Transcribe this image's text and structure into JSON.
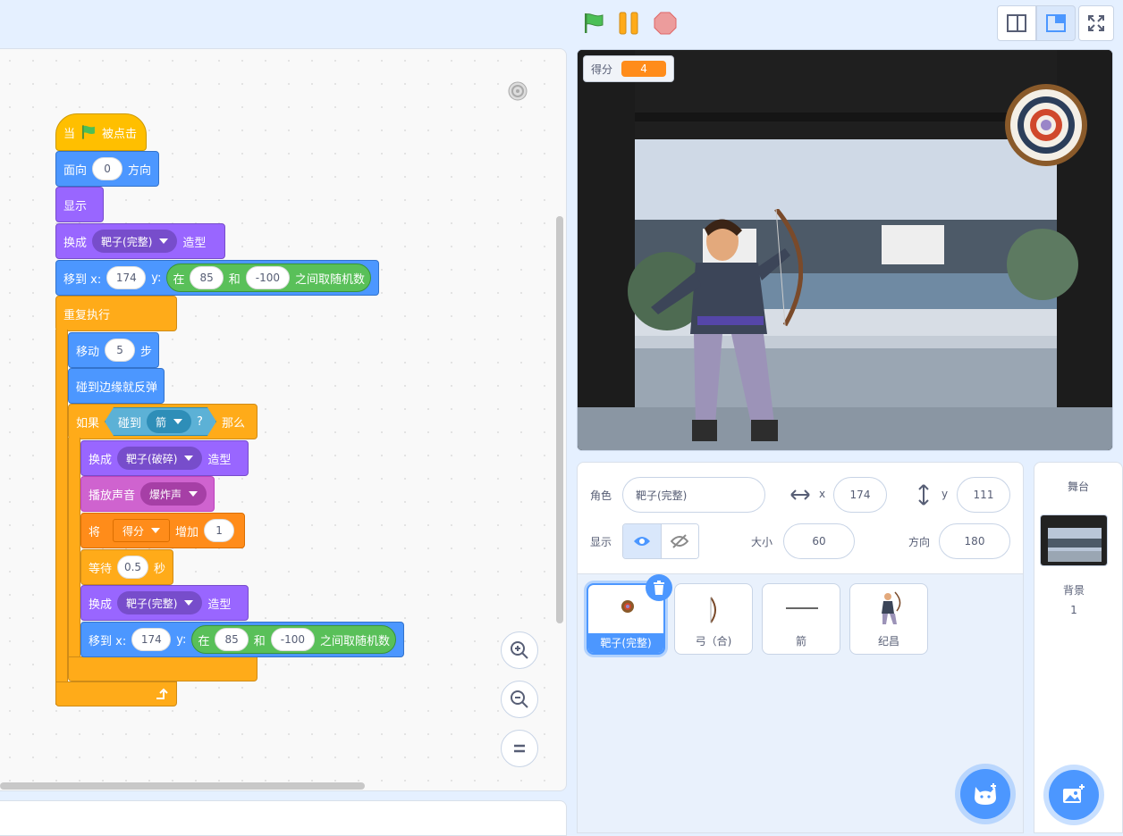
{
  "stage_monitor": {
    "label": "得分",
    "value": "4"
  },
  "blocks": {
    "when_flag": {
      "pre": "当",
      "post": "被点击"
    },
    "point": {
      "pre": "面向",
      "value": "0",
      "post": "方向"
    },
    "show": "显示",
    "switch1": {
      "pre": "换成",
      "costume": "靶子(完整)",
      "post": "造型"
    },
    "goto1": {
      "pre": "移到 x:",
      "x": "174",
      "y_label": "y:",
      "rand_pre": "在",
      "a": "85",
      "and": "和",
      "b": "-100",
      "rand_post": "之间取随机数"
    },
    "forever": "重复执行",
    "move": {
      "pre": "移动",
      "value": "5",
      "post": "步"
    },
    "bounce": "碰到边缘就反弹",
    "if": {
      "pre": "如果",
      "touch": "碰到",
      "target": "箭",
      "q": "?",
      "post": "那么"
    },
    "switch2": {
      "pre": "换成",
      "costume": "靶子(破碎)",
      "post": "造型"
    },
    "play": {
      "pre": "播放声音",
      "sound": "爆炸声"
    },
    "change": {
      "pre": "将",
      "var": "得分",
      "mid": "增加",
      "value": "1"
    },
    "wait": {
      "pre": "等待",
      "value": "0.5",
      "post": "秒"
    },
    "switch3": {
      "pre": "换成",
      "costume": "靶子(完整)",
      "post": "造型"
    },
    "goto2": {
      "pre": "移到 x:",
      "x": "174",
      "y_label": "y:",
      "rand_pre": "在",
      "a": "85",
      "and": "和",
      "b": "-100",
      "rand_post": "之间取随机数"
    }
  },
  "sprite_info": {
    "sprite_label": "角色",
    "sprite_name": "靶子(完整)",
    "x_label": "x",
    "x_value": "174",
    "y_label": "y",
    "y_value": "111",
    "show_label": "显示",
    "size_label": "大小",
    "size_value": "60",
    "direction_label": "方向",
    "direction_value": "180"
  },
  "sprites": [
    {
      "name": "靶子(完整)",
      "selected": true
    },
    {
      "name": "弓（合)"
    },
    {
      "name": "箭"
    },
    {
      "name": "纪昌"
    }
  ],
  "stage_panel": {
    "title": "舞台",
    "backdrop_label": "背景",
    "backdrop_count": "1"
  },
  "colors": {
    "motion": "#4c97ff",
    "looks": "#9966ff",
    "sound": "#cf63cf",
    "events": "#ffbf00",
    "control": "#ffab19",
    "variables": "#ff8c1a",
    "operators": "#59c059",
    "sensing": "#5cb1d6"
  }
}
